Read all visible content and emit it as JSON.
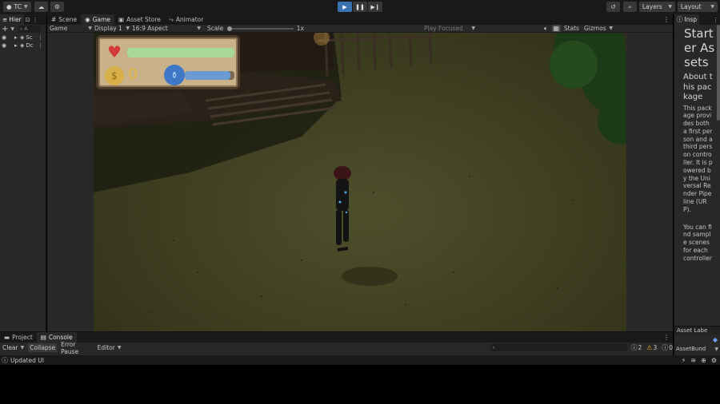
{
  "toolbar": {
    "account": "TC",
    "layers": "Layers",
    "layout": "Layout"
  },
  "tabs": {
    "hierarchy": "Hier",
    "scene": "Scene",
    "game": "Game",
    "asset_store": "Asset Store",
    "animator": "Animator",
    "inspector": "Insp"
  },
  "hierarchy": {
    "search_placeholder": "A",
    "items": [
      {
        "label": "Sc"
      },
      {
        "label": "Dc"
      }
    ]
  },
  "game_bar": {
    "mode": "Game",
    "display": "Display 1",
    "aspect": "16:9 Aspect",
    "scale_label": "Scale",
    "scale_value": "1x",
    "play_focused": "Play Focused",
    "stats": "Stats",
    "gizmos": "Gizmos"
  },
  "hud": {
    "coins": "0",
    "health_fill": 1.0,
    "mana_fill": 0.92
  },
  "inspector": {
    "title": "Starter Assets",
    "heading": "About this package",
    "body_1": "This package provides both a first person and a third person controller. It is powered by the Universal Render Pipeline (URP).",
    "body_2": "You can find sample scenes for each controller",
    "asset_labels": "Asset Labe",
    "asset_bundle": "AssetBund"
  },
  "bottom": {
    "project_tab": "Project",
    "console_tab": "Console",
    "clear": "Clear",
    "collapse": "Collapse",
    "error_pause": "Error Pause",
    "editor": "Editor",
    "count_info": "2",
    "count_warn": "3",
    "count_error": "0"
  },
  "status": {
    "message": "Updated UI"
  },
  "colors": {
    "accent": "#3a72b0",
    "panel": "#282828",
    "dark": "#191919"
  }
}
